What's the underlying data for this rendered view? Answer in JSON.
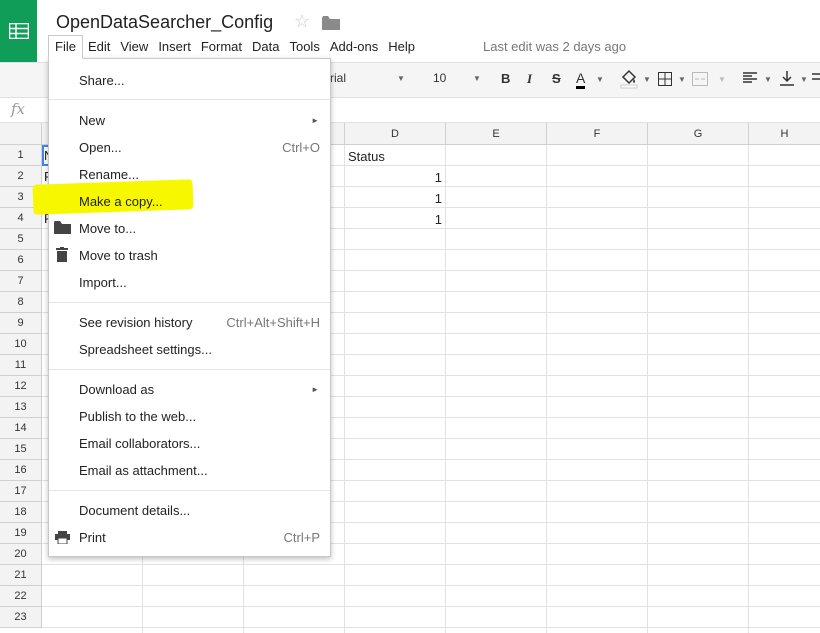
{
  "doc": {
    "title": "OpenDataSearcher_Config",
    "star_icon": "☆",
    "last_edit": "Last edit was 2 days ago"
  },
  "menubar": [
    "File",
    "Edit",
    "View",
    "Insert",
    "Format",
    "Data",
    "Tools",
    "Add-ons",
    "Help"
  ],
  "toolbar": {
    "font": "rial",
    "font_size": "10",
    "bold": "B",
    "italic": "I",
    "strike": "S",
    "text_color": "A"
  },
  "formula_bar": {
    "fx": "fx"
  },
  "columns": [
    "D",
    "E",
    "F",
    "G",
    "H"
  ],
  "rows": [
    "1",
    "2",
    "3",
    "4",
    "5",
    "6",
    "7",
    "8",
    "9",
    "10",
    "11",
    "12",
    "13",
    "14",
    "15",
    "16",
    "17",
    "18",
    "19",
    "20",
    "21",
    "22",
    "23"
  ],
  "cells": {
    "d1": "Status",
    "d2": "1",
    "d3": "1",
    "d4": "1",
    "a1": "N",
    "a2": "F",
    "a3": "F",
    "a4": "F"
  },
  "file_menu": {
    "share": "Share...",
    "new": "New",
    "open": "Open...",
    "open_sc": "Ctrl+O",
    "rename": "Rename...",
    "make_copy": "Make a copy...",
    "move_to": "Move to...",
    "move_trash": "Move to trash",
    "import": "Import...",
    "revision": "See revision history",
    "revision_sc": "Ctrl+Alt+Shift+H",
    "settings": "Spreadsheet settings...",
    "download": "Download as",
    "publish": "Publish to the web...",
    "email_collab": "Email collaborators...",
    "email_attach": "Email as attachment...",
    "details": "Document details...",
    "print": "Print",
    "print_sc": "Ctrl+P",
    "arrow": "►"
  },
  "colors": {
    "brand": "#0f9d58",
    "highlight": "#f7f700"
  }
}
